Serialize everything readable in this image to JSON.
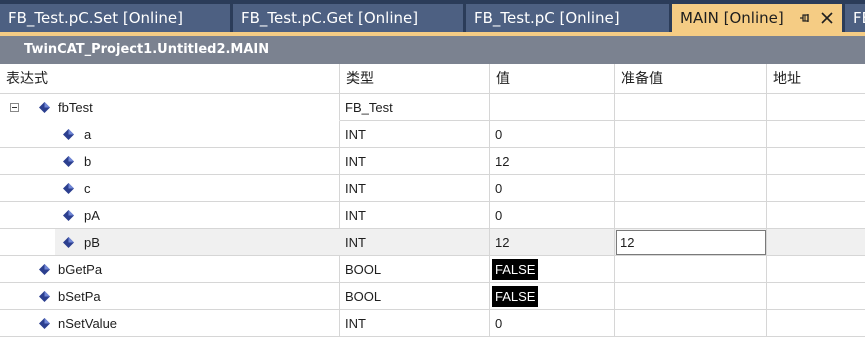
{
  "tabs": [
    {
      "label": "FB_Test.pC.Set [Online]"
    },
    {
      "label": "FB_Test.pC.Get [Online]"
    },
    {
      "label": "FB_Test.pC [Online]"
    },
    {
      "label": "MAIN [Online]"
    },
    {
      "label": "FB"
    }
  ],
  "path": "TwinCAT_Project1.Untitled2.MAIN",
  "columns": [
    "表达式",
    "类型",
    "值",
    "准备值",
    "地址"
  ],
  "rows": [
    {
      "name": "fbTest",
      "type": "FB_Test",
      "value": "",
      "prepared": ""
    },
    {
      "name": "a",
      "type": "INT",
      "value": "0",
      "prepared": ""
    },
    {
      "name": "b",
      "type": "INT",
      "value": "12",
      "prepared": ""
    },
    {
      "name": "c",
      "type": "INT",
      "value": "0",
      "prepared": ""
    },
    {
      "name": "pA",
      "type": "INT",
      "value": "0",
      "prepared": ""
    },
    {
      "name": "pB",
      "type": "INT",
      "value": "12",
      "prepared": "12"
    },
    {
      "name": "bGetPa",
      "type": "BOOL",
      "value": "FALSE",
      "prepared": ""
    },
    {
      "name": "bSetPa",
      "type": "BOOL",
      "value": "FALSE",
      "prepared": ""
    },
    {
      "name": "nSetValue",
      "type": "INT",
      "value": "0",
      "prepared": ""
    }
  ],
  "colors": {
    "tab_strip": "#2b3c59",
    "tab_inactive": "#4d6082",
    "tab_active": "#f5cc84",
    "path_bar": "#7b8290",
    "variable_icon": "#2c3f8f",
    "bool_background": "#000000"
  },
  "icons": {
    "variable": "blue-diamond-variable-icon",
    "expander": "tree-collapse-minus-icon",
    "pin": "pin-icon",
    "close": "close-icon"
  }
}
